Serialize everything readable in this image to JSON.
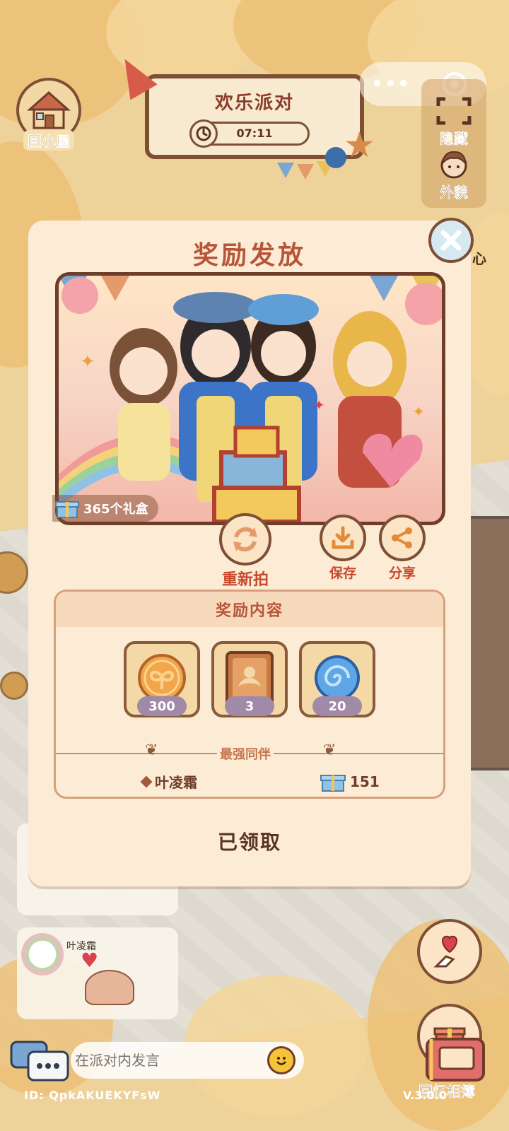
{
  "home": {
    "label": "回小屋"
  },
  "party": {
    "title": "欢乐派对",
    "timer": "07:11"
  },
  "capsule": {
    "menu": "•••"
  },
  "side": {
    "hide_label": "隐藏",
    "appearance_label": "外貌",
    "clipped_label": "心"
  },
  "modal": {
    "title": "奖励发放",
    "gift_count": "365个礼盒",
    "actions": {
      "retake": "重新拍",
      "save": "保存",
      "share": "分享"
    },
    "reward": {
      "header": "奖励内容",
      "items": [
        {
          "icon": "sprout-coin-icon",
          "qty": "300"
        },
        {
          "icon": "book-icon",
          "qty": "3"
        },
        {
          "icon": "swirl-orb-icon",
          "qty": "20"
        }
      ],
      "caption": "最强同伴",
      "friend": "叶凌霜",
      "gifts": "151"
    },
    "claimed": "已领取"
  },
  "chat": {
    "user": "叶凌霜",
    "placeholder": "在派对内发言"
  },
  "footer": {
    "id": "ID:  QpkAKUEKYFsW",
    "version": "V.3.0.0"
  },
  "album": {
    "label": "回忆相簿"
  },
  "colors": {
    "accent": "#b7553a",
    "border": "#7d5036",
    "panel": "#fcecd6"
  }
}
